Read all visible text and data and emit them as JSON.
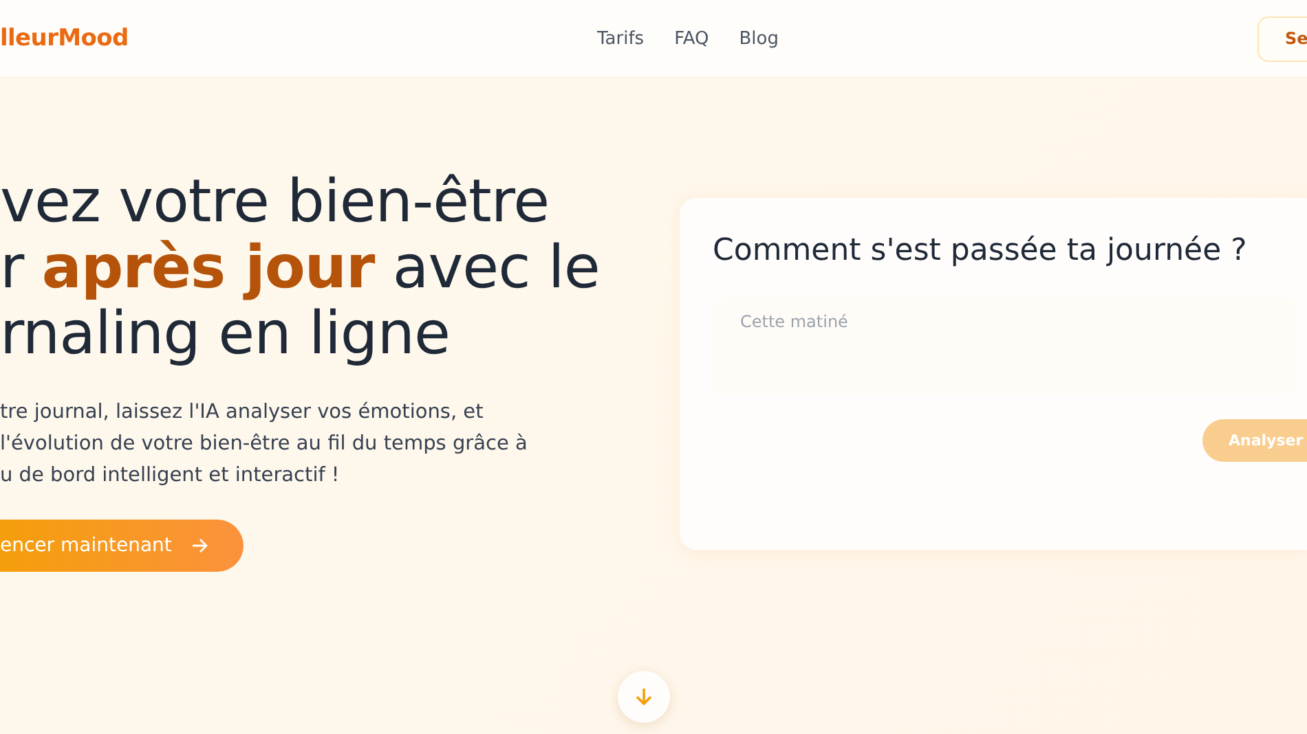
{
  "header": {
    "logo": "lleurMood",
    "nav": [
      "Tarifs",
      "FAQ",
      "Blog"
    ],
    "action": "Se"
  },
  "hero": {
    "headline": [
      "vez votre bien-être",
      "r **après jour** avec le",
      "rnaling en ligne"
    ],
    "description": [
      "tre journal, laissez l'IA analyser vos émotions, et",
      "l'évolution de votre bien-être au fil du temps grâce à",
      "u de bord intelligent et interactif !"
    ],
    "cta": {
      "label": "encer maintenant"
    }
  },
  "journal_card": {
    "title": "Comment s'est passée ta journée ?",
    "placeholder": "Cette matiné",
    "submit": {
      "label": "Analyser",
      "disabled": true
    }
  }
}
